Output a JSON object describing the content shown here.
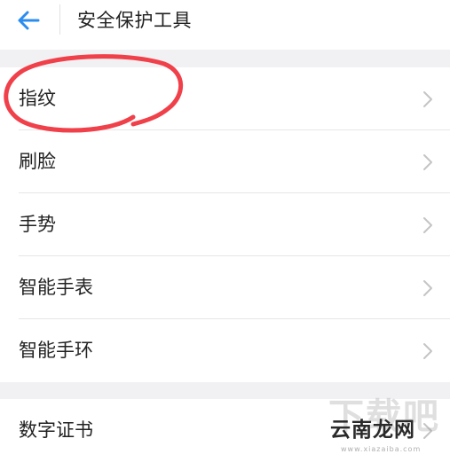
{
  "header": {
    "title": "安全保护工具",
    "back_icon": "arrow-left-icon"
  },
  "colors": {
    "accent": "#2b8cf0",
    "annotation_circle": "#f0404a",
    "separator_band": "#f1f1f3"
  },
  "sections": [
    {
      "items": [
        {
          "label": "指纹",
          "icon": "chevron-right-icon",
          "annotated": true
        },
        {
          "label": "刷脸",
          "icon": "chevron-right-icon"
        },
        {
          "label": "手势",
          "icon": "chevron-right-icon"
        },
        {
          "label": "智能手表",
          "icon": "chevron-right-icon"
        },
        {
          "label": "智能手环",
          "icon": "chevron-right-icon"
        }
      ]
    },
    {
      "items": [
        {
          "label": "数字证书",
          "icon": "chevron-right-icon"
        }
      ]
    }
  ],
  "watermark": {
    "brand": "云南龙网",
    "background_text": "下载吧",
    "url": "www.xiazaiba.com"
  }
}
